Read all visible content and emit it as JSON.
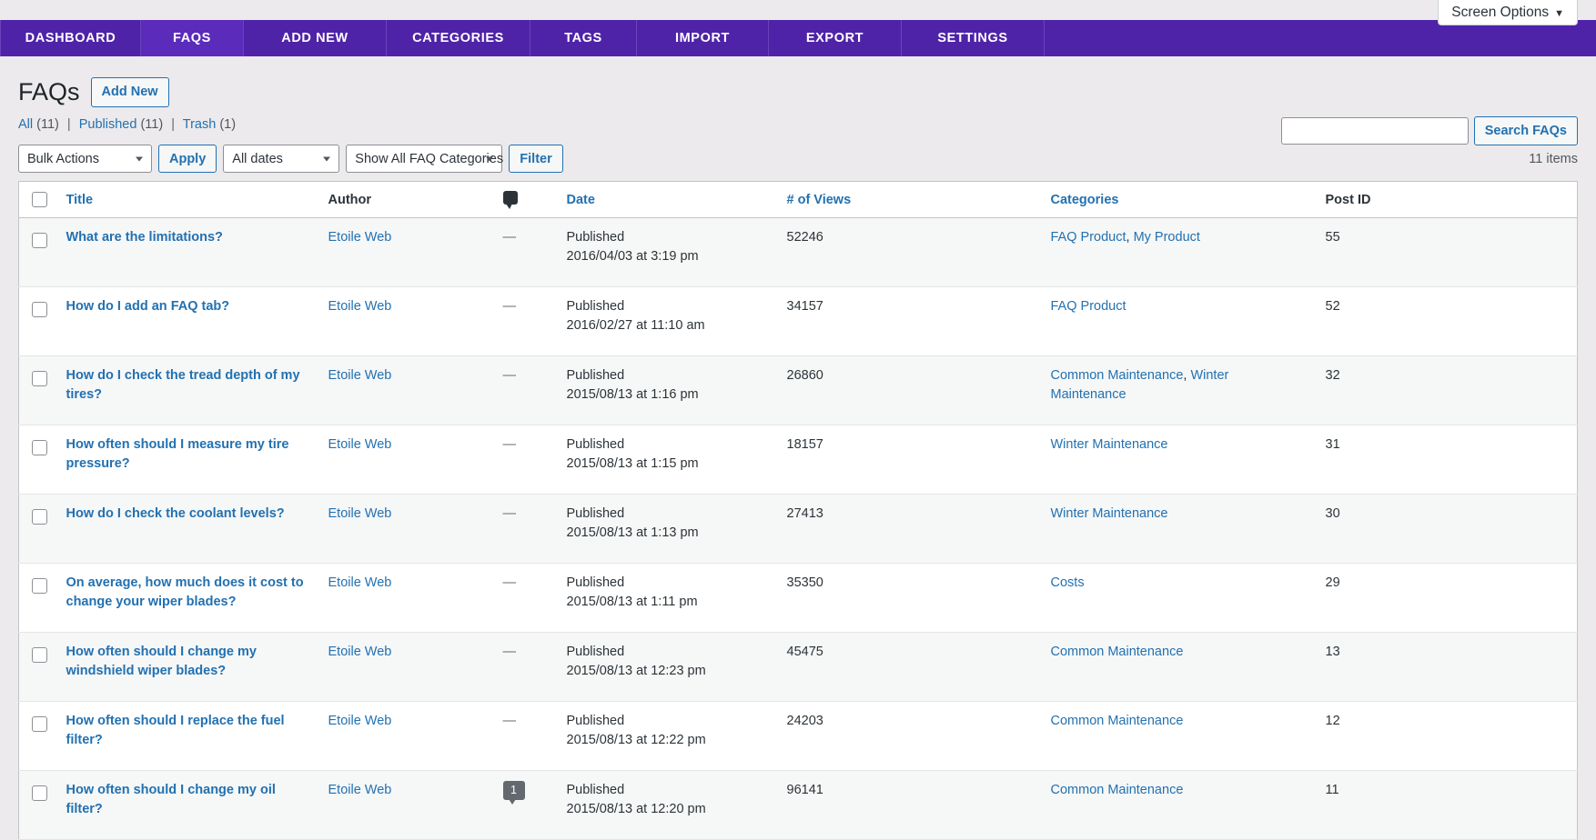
{
  "screen_options": {
    "label": "Screen Options",
    "caret": "▼"
  },
  "nav": {
    "items": [
      {
        "label": "DASHBOARD",
        "active": false
      },
      {
        "label": "FAQS",
        "active": true
      },
      {
        "label": "ADD NEW",
        "active": false
      },
      {
        "label": "CATEGORIES",
        "active": false
      },
      {
        "label": "TAGS",
        "active": false
      },
      {
        "label": "IMPORT",
        "active": false
      },
      {
        "label": "EXPORT",
        "active": false
      },
      {
        "label": "SETTINGS",
        "active": false
      }
    ]
  },
  "header": {
    "title": "FAQs",
    "add_new_label": "Add New"
  },
  "status_links": {
    "all_label": "All",
    "all_count": "(11)",
    "published_label": "Published",
    "published_count": "(11)",
    "trash_label": "Trash",
    "trash_count": "(1)",
    "separator": "|"
  },
  "search": {
    "value": "",
    "placeholder": "",
    "submit_label": "Search FAQs"
  },
  "tablenav": {
    "bulk_actions": "Bulk Actions",
    "apply_label": "Apply",
    "dates": "All dates",
    "categories": "Show All FAQ Categories",
    "filter_label": "Filter",
    "displaying_num": "11 items"
  },
  "table": {
    "columns": {
      "title": "Title",
      "author": "Author",
      "comments": "comment-bubble-icon",
      "date": "Date",
      "views": "# of Views",
      "categories": "Categories",
      "post_id": "Post ID"
    },
    "rows": [
      {
        "title": "What are the limitations?",
        "author": "Etoile Web",
        "comments": "—",
        "comment_count": null,
        "date_status": "Published",
        "date_value": "2016/04/03 at 3:19 pm",
        "views": "52246",
        "categories": "FAQ Product, My Product",
        "post_id": "55"
      },
      {
        "title": "How do I add an FAQ tab?",
        "author": "Etoile Web",
        "comments": "—",
        "comment_count": null,
        "date_status": "Published",
        "date_value": "2016/02/27 at 11:10 am",
        "views": "34157",
        "categories": "FAQ Product",
        "post_id": "52"
      },
      {
        "title": "How do I check the tread depth of my tires?",
        "author": "Etoile Web",
        "comments": "—",
        "comment_count": null,
        "date_status": "Published",
        "date_value": "2015/08/13 at 1:16 pm",
        "views": "26860",
        "categories": "Common Maintenance, Winter Maintenance",
        "post_id": "32"
      },
      {
        "title": "How often should I measure my tire pressure?",
        "author": "Etoile Web",
        "comments": "—",
        "comment_count": null,
        "date_status": "Published",
        "date_value": "2015/08/13 at 1:15 pm",
        "views": "18157",
        "categories": "Winter Maintenance",
        "post_id": "31"
      },
      {
        "title": "How do I check the coolant levels?",
        "author": "Etoile Web",
        "comments": "—",
        "comment_count": null,
        "date_status": "Published",
        "date_value": "2015/08/13 at 1:13 pm",
        "views": "27413",
        "categories": "Winter Maintenance",
        "post_id": "30"
      },
      {
        "title": "On average, how much does it cost to change your wiper blades?",
        "author": "Etoile Web",
        "comments": "—",
        "comment_count": null,
        "date_status": "Published",
        "date_value": "2015/08/13 at 1:11 pm",
        "views": "35350",
        "categories": "Costs",
        "post_id": "29"
      },
      {
        "title": "How often should I change my windshield wiper blades?",
        "author": "Etoile Web",
        "comments": "—",
        "comment_count": null,
        "date_status": "Published",
        "date_value": "2015/08/13 at 12:23 pm",
        "views": "45475",
        "categories": "Common Maintenance",
        "post_id": "13"
      },
      {
        "title": "How often should I replace the fuel filter?",
        "author": "Etoile Web",
        "comments": "—",
        "comment_count": null,
        "date_status": "Published",
        "date_value": "2015/08/13 at 12:22 pm",
        "views": "24203",
        "categories": "Common Maintenance",
        "post_id": "12"
      },
      {
        "title": "How often should I change my oil filter?",
        "author": "Etoile Web",
        "comments": "",
        "comment_count": "1",
        "date_status": "Published",
        "date_value": "2015/08/13 at 12:20 pm",
        "views": "96141",
        "categories": "Common Maintenance",
        "post_id": "11"
      }
    ]
  },
  "colors": {
    "nav_bg": "#4f23a8",
    "nav_active": "#5b2bbb",
    "link": "#2271b1",
    "page_bg": "#eceaec"
  }
}
